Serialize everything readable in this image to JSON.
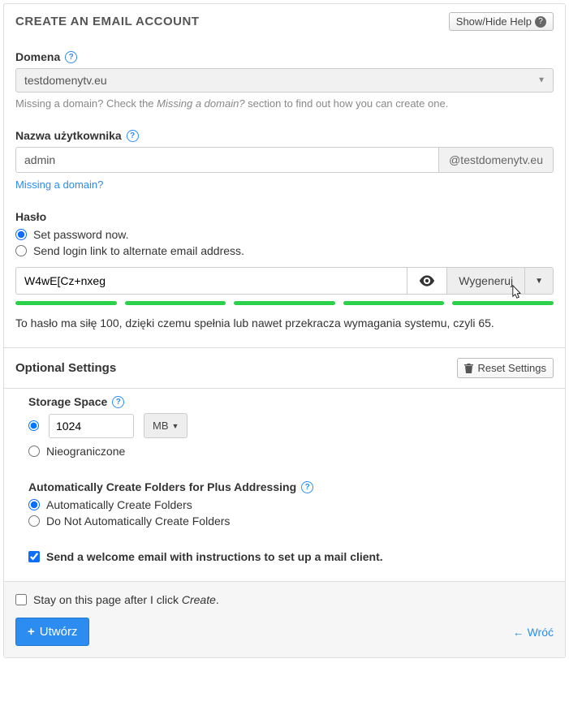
{
  "header": {
    "title": "CREATE AN EMAIL ACCOUNT",
    "help_btn": "Show/Hide Help"
  },
  "domain": {
    "label": "Domena",
    "value": "testdomenytv.eu",
    "hint_prefix": "Missing a domain? Check the ",
    "hint_em": "Missing a domain?",
    "hint_suffix": " section to find out how you can create one."
  },
  "username": {
    "label": "Nazwa użytkownika",
    "value": "admin",
    "suffix": "@testdomenytv.eu",
    "missing_link": "Missing a domain?"
  },
  "password": {
    "label": "Hasło",
    "opt_now": "Set password now.",
    "opt_link": "Send login link to alternate email address.",
    "value": "W4wE[Cz+nxeg",
    "generate": "Wygeneruj",
    "strength_note": "To hasło ma siłę 100, dzięki czemu spełnia lub nawet przekracza wymagania systemu, czyli 65."
  },
  "optional": {
    "title": "Optional Settings",
    "reset": "Reset Settings",
    "storage": {
      "label": "Storage Space",
      "value": "1024",
      "unit": "MB",
      "opt_unlimited": "Nieograniczone"
    },
    "plus": {
      "label": "Automatically Create Folders for Plus Addressing",
      "opt_auto": "Automatically Create Folders",
      "opt_no": "Do Not Automatically Create Folders"
    },
    "welcome": "Send a welcome email with instructions to set up a mail client."
  },
  "footer": {
    "stay_prefix": "Stay on this page after I click ",
    "stay_em": "Create",
    "create": "Utwórz",
    "back": "Wróć"
  }
}
